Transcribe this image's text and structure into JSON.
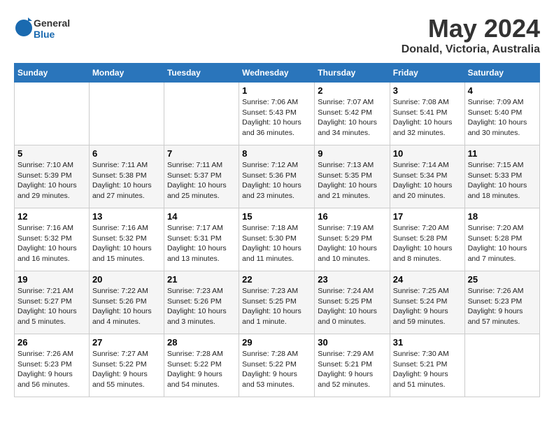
{
  "logo": {
    "general": "General",
    "blue": "Blue"
  },
  "title": "May 2024",
  "subtitle": "Donald, Victoria, Australia",
  "weekdays": [
    "Sunday",
    "Monday",
    "Tuesday",
    "Wednesday",
    "Thursday",
    "Friday",
    "Saturday"
  ],
  "weeks": [
    [
      {
        "day": "",
        "info": ""
      },
      {
        "day": "",
        "info": ""
      },
      {
        "day": "",
        "info": ""
      },
      {
        "day": "1",
        "info": "Sunrise: 7:06 AM\nSunset: 5:43 PM\nDaylight: 10 hours\nand 36 minutes."
      },
      {
        "day": "2",
        "info": "Sunrise: 7:07 AM\nSunset: 5:42 PM\nDaylight: 10 hours\nand 34 minutes."
      },
      {
        "day": "3",
        "info": "Sunrise: 7:08 AM\nSunset: 5:41 PM\nDaylight: 10 hours\nand 32 minutes."
      },
      {
        "day": "4",
        "info": "Sunrise: 7:09 AM\nSunset: 5:40 PM\nDaylight: 10 hours\nand 30 minutes."
      }
    ],
    [
      {
        "day": "5",
        "info": "Sunrise: 7:10 AM\nSunset: 5:39 PM\nDaylight: 10 hours\nand 29 minutes."
      },
      {
        "day": "6",
        "info": "Sunrise: 7:11 AM\nSunset: 5:38 PM\nDaylight: 10 hours\nand 27 minutes."
      },
      {
        "day": "7",
        "info": "Sunrise: 7:11 AM\nSunset: 5:37 PM\nDaylight: 10 hours\nand 25 minutes."
      },
      {
        "day": "8",
        "info": "Sunrise: 7:12 AM\nSunset: 5:36 PM\nDaylight: 10 hours\nand 23 minutes."
      },
      {
        "day": "9",
        "info": "Sunrise: 7:13 AM\nSunset: 5:35 PM\nDaylight: 10 hours\nand 21 minutes."
      },
      {
        "day": "10",
        "info": "Sunrise: 7:14 AM\nSunset: 5:34 PM\nDaylight: 10 hours\nand 20 minutes."
      },
      {
        "day": "11",
        "info": "Sunrise: 7:15 AM\nSunset: 5:33 PM\nDaylight: 10 hours\nand 18 minutes."
      }
    ],
    [
      {
        "day": "12",
        "info": "Sunrise: 7:16 AM\nSunset: 5:32 PM\nDaylight: 10 hours\nand 16 minutes."
      },
      {
        "day": "13",
        "info": "Sunrise: 7:16 AM\nSunset: 5:32 PM\nDaylight: 10 hours\nand 15 minutes."
      },
      {
        "day": "14",
        "info": "Sunrise: 7:17 AM\nSunset: 5:31 PM\nDaylight: 10 hours\nand 13 minutes."
      },
      {
        "day": "15",
        "info": "Sunrise: 7:18 AM\nSunset: 5:30 PM\nDaylight: 10 hours\nand 11 minutes."
      },
      {
        "day": "16",
        "info": "Sunrise: 7:19 AM\nSunset: 5:29 PM\nDaylight: 10 hours\nand 10 minutes."
      },
      {
        "day": "17",
        "info": "Sunrise: 7:20 AM\nSunset: 5:28 PM\nDaylight: 10 hours\nand 8 minutes."
      },
      {
        "day": "18",
        "info": "Sunrise: 7:20 AM\nSunset: 5:28 PM\nDaylight: 10 hours\nand 7 minutes."
      }
    ],
    [
      {
        "day": "19",
        "info": "Sunrise: 7:21 AM\nSunset: 5:27 PM\nDaylight: 10 hours\nand 5 minutes."
      },
      {
        "day": "20",
        "info": "Sunrise: 7:22 AM\nSunset: 5:26 PM\nDaylight: 10 hours\nand 4 minutes."
      },
      {
        "day": "21",
        "info": "Sunrise: 7:23 AM\nSunset: 5:26 PM\nDaylight: 10 hours\nand 3 minutes."
      },
      {
        "day": "22",
        "info": "Sunrise: 7:23 AM\nSunset: 5:25 PM\nDaylight: 10 hours\nand 1 minute."
      },
      {
        "day": "23",
        "info": "Sunrise: 7:24 AM\nSunset: 5:25 PM\nDaylight: 10 hours\nand 0 minutes."
      },
      {
        "day": "24",
        "info": "Sunrise: 7:25 AM\nSunset: 5:24 PM\nDaylight: 9 hours\nand 59 minutes."
      },
      {
        "day": "25",
        "info": "Sunrise: 7:26 AM\nSunset: 5:23 PM\nDaylight: 9 hours\nand 57 minutes."
      }
    ],
    [
      {
        "day": "26",
        "info": "Sunrise: 7:26 AM\nSunset: 5:23 PM\nDaylight: 9 hours\nand 56 minutes."
      },
      {
        "day": "27",
        "info": "Sunrise: 7:27 AM\nSunset: 5:22 PM\nDaylight: 9 hours\nand 55 minutes."
      },
      {
        "day": "28",
        "info": "Sunrise: 7:28 AM\nSunset: 5:22 PM\nDaylight: 9 hours\nand 54 minutes."
      },
      {
        "day": "29",
        "info": "Sunrise: 7:28 AM\nSunset: 5:22 PM\nDaylight: 9 hours\nand 53 minutes."
      },
      {
        "day": "30",
        "info": "Sunrise: 7:29 AM\nSunset: 5:21 PM\nDaylight: 9 hours\nand 52 minutes."
      },
      {
        "day": "31",
        "info": "Sunrise: 7:30 AM\nSunset: 5:21 PM\nDaylight: 9 hours\nand 51 minutes."
      },
      {
        "day": "",
        "info": ""
      }
    ]
  ]
}
